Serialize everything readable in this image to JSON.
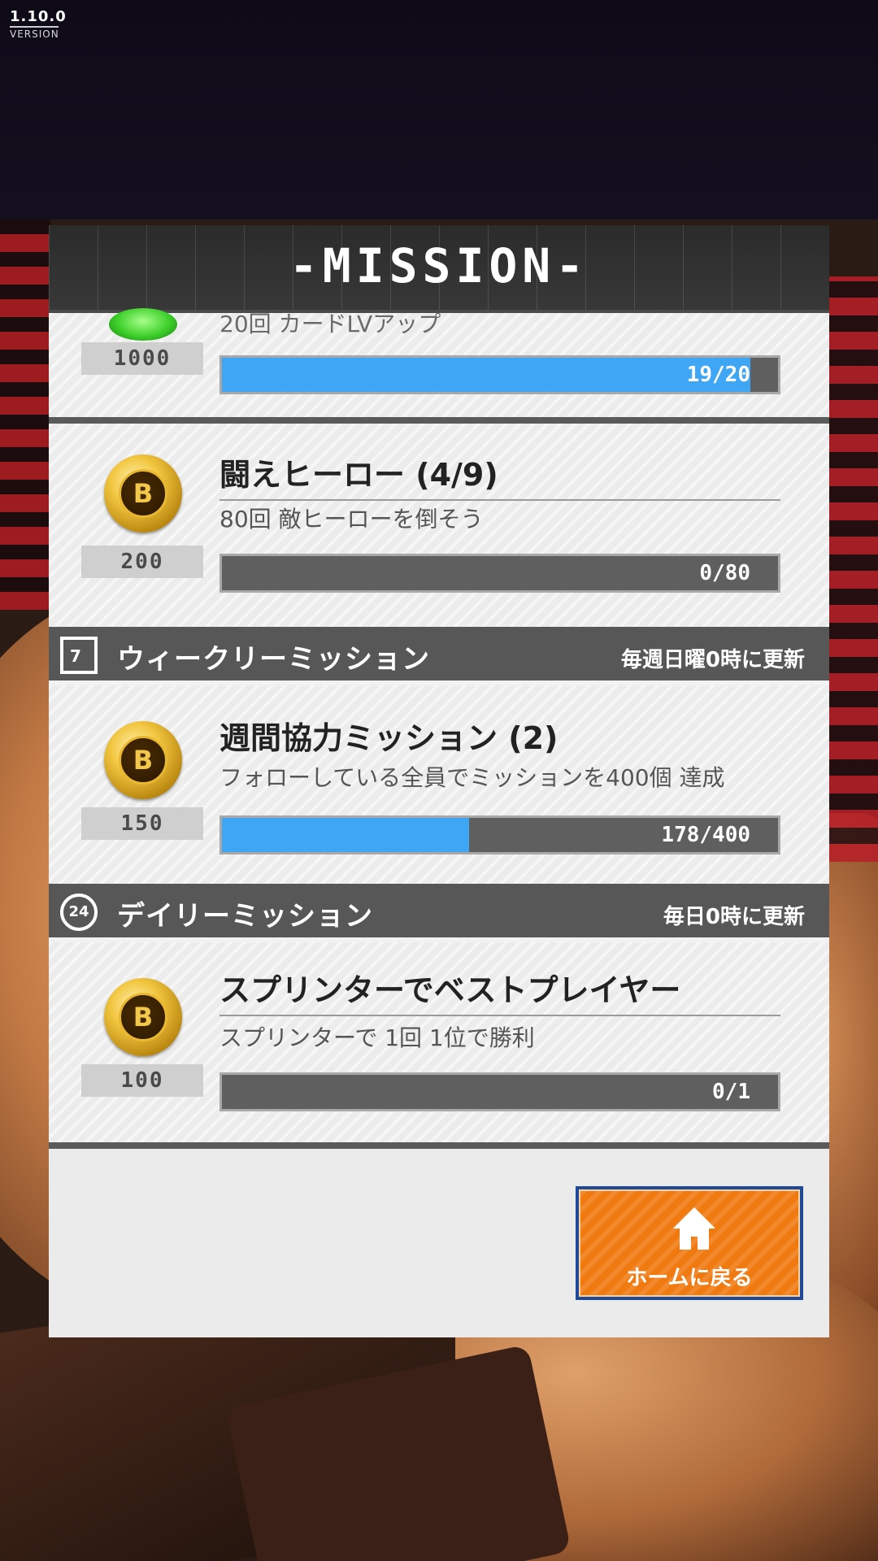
{
  "version": {
    "number": "1.10.0",
    "label": "VERSION"
  },
  "panel": {
    "title": "-MISSION-"
  },
  "missions_top": [
    {
      "title": "",
      "desc": "20回 カードLVアップ",
      "reward": "1000",
      "progress_text": "19/20",
      "progress": 0.95,
      "reward_type": "gem-icon"
    },
    {
      "title": "闘えヒーロー (4/9)",
      "desc": "80回 敵ヒーローを倒そう",
      "reward": "200",
      "progress_text": "0/80",
      "progress": 0.0,
      "reward_type": "coin-icon"
    }
  ],
  "weekly": {
    "label": "ウィークリーミッション",
    "reset": "毎週日曜0時に更新",
    "icon_text": "7",
    "missions": [
      {
        "title": "週間協力ミッション (2)",
        "desc": "フォローしている全員でミッションを400個 達成",
        "reward": "150",
        "progress_text": "178/400",
        "progress": 0.445
      }
    ]
  },
  "daily": {
    "label": "デイリーミッション",
    "reset": "毎日0時に更新",
    "icon_text": "24",
    "missions": [
      {
        "title": "スプリンターでベストプレイヤー",
        "desc": "スプリンターで 1回 1位で勝利",
        "reward": "100",
        "progress_text": "0/1",
        "progress": 0.0
      }
    ]
  },
  "coin_glyph": "B",
  "home_button": {
    "label": "ホームに戻る"
  },
  "colors": {
    "accent_blue": "#3ea6f4",
    "button_orange": "#f07a10",
    "section_gray": "#575757"
  }
}
